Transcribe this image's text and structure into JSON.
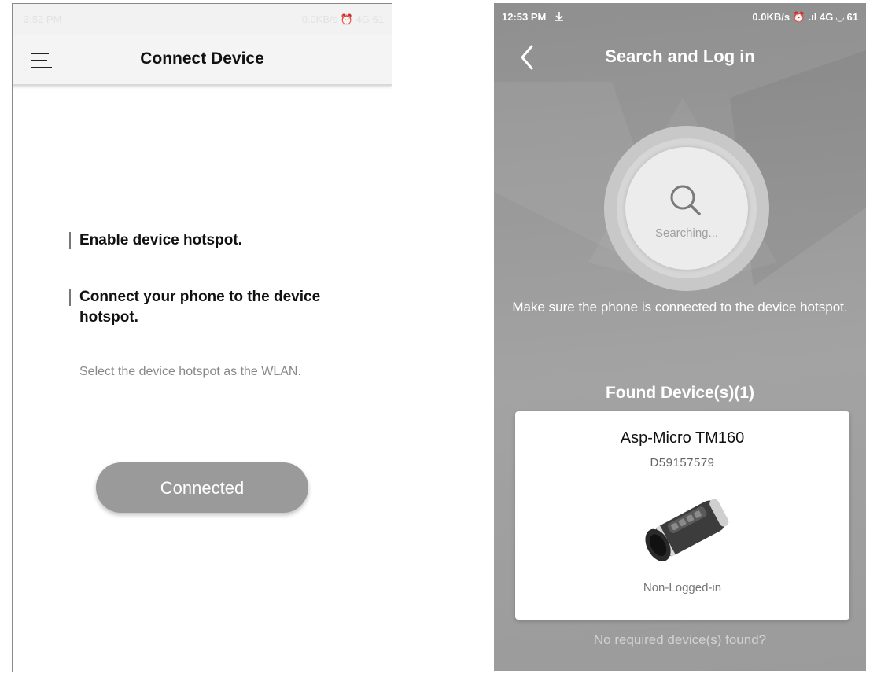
{
  "left_screen": {
    "status_bar": {
      "time": "3:52 PM",
      "right": "0.0KB/s ⏰ 4G 61"
    },
    "header": {
      "title": "Connect Device",
      "menu_icon": "hamburger-menu-icon"
    },
    "steps": [
      {
        "text": "Enable device hotspot."
      },
      {
        "text": "Connect your phone to the device hotspot."
      }
    ],
    "hint": "Select the device hotspot as the WLAN.",
    "connected_button": "Connected",
    "colors": {
      "header_bg": "#f4f4f4",
      "button_bg": "#9a9a9a"
    }
  },
  "right_screen": {
    "status_bar": {
      "time": "12:53 PM",
      "download_icon": "download-arrow-icon",
      "right": "0.0KB/s ⏰ .ıl 4G ◡ 61"
    },
    "header": {
      "title": "Search and Log in",
      "back_icon": "chevron-left-icon"
    },
    "search": {
      "icon": "magnifier-icon",
      "label": "Searching..."
    },
    "hotspot_note": "Make sure the phone is connected to the device hotspot.",
    "found_heading": "Found Device(s)(1)",
    "devices": [
      {
        "name": "Asp-Micro TM160",
        "serial": "D59157579",
        "status": "Non-Logged-in",
        "image_icon": "thermal-monocular-icon"
      }
    ],
    "no_device_link": "No required device(s) found?",
    "colors": {
      "background": "#9c9c9c",
      "card_bg": "#ffffff"
    }
  }
}
